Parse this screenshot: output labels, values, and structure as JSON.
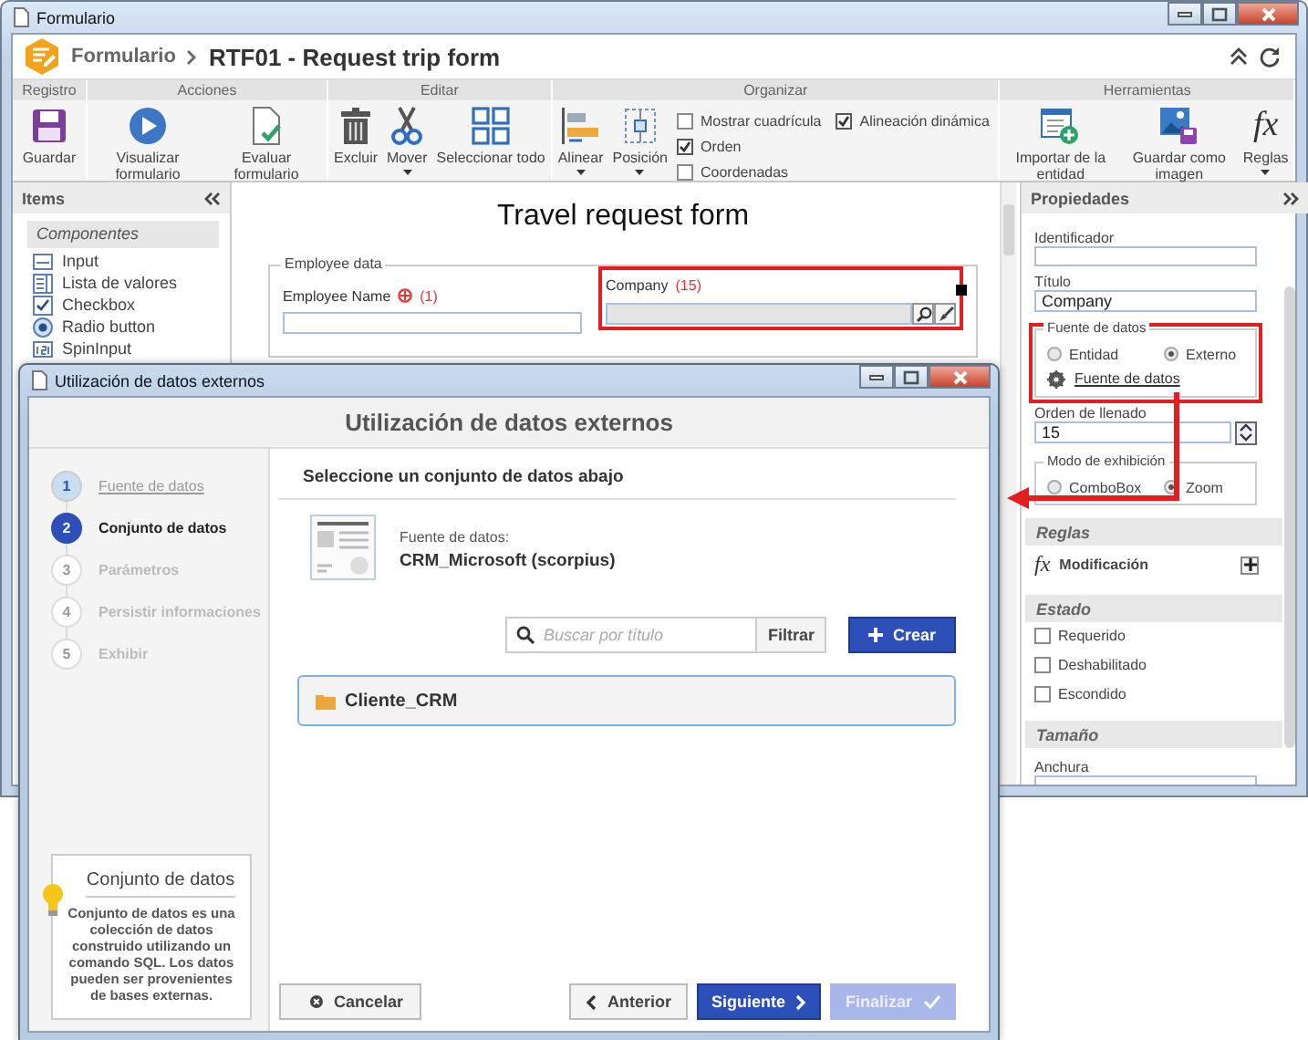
{
  "window": {
    "title": "Formulario"
  },
  "header": {
    "section": "Formulario",
    "title": "RTF01 - Request trip form"
  },
  "ribbon": [
    {
      "label": "Registro",
      "items": [
        {
          "kind": "button",
          "label": "Guardar"
        }
      ]
    },
    {
      "label": "Acciones",
      "items": [
        {
          "kind": "button",
          "label": "Visualizar formulario"
        },
        {
          "kind": "button",
          "label": "Evaluar formulario"
        }
      ]
    },
    {
      "label": "Editar",
      "items": [
        {
          "kind": "button",
          "label": "Excluir"
        },
        {
          "kind": "dropdown",
          "label": "Mover"
        },
        {
          "kind": "button",
          "label": "Seleccionar todo"
        }
      ]
    },
    {
      "label": "Organizar",
      "items": [
        {
          "kind": "dropdown",
          "label": "Alinear"
        },
        {
          "kind": "dropdown",
          "label": "Posición"
        },
        {
          "kind": "checks",
          "options": [
            {
              "label": "Mostrar cuadrícula",
              "checked": false
            },
            {
              "label": "Orden",
              "checked": true
            },
            {
              "label": "Coordenadas",
              "checked": false
            },
            {
              "label": "Alineación dinámica",
              "checked": true
            }
          ]
        }
      ]
    },
    {
      "label": "Herramientas",
      "items": [
        {
          "kind": "button",
          "label": "Importar de la entidad"
        },
        {
          "kind": "button",
          "label": "Guardar como imagen"
        },
        {
          "kind": "dropdown",
          "label": "Reglas",
          "symbol": "fx"
        }
      ]
    }
  ],
  "items_panel": {
    "title": "Items",
    "section": "Componentes",
    "components": [
      "Input",
      "Lista de valores",
      "Checkbox",
      "Radio button",
      "SpinInput"
    ]
  },
  "form": {
    "title": "Travel request form",
    "section": "Employee data",
    "fields": [
      {
        "kind": "text",
        "label": "Employee Name",
        "required": true,
        "order": "(1)",
        "highlighted": false
      },
      {
        "kind": "zoom",
        "label": "Company",
        "required": false,
        "order": "(15)",
        "highlighted": true
      }
    ]
  },
  "properties": {
    "title": "Propiedades",
    "identifier": {
      "label": "Identificador"
    },
    "caption": {
      "label": "Título",
      "value": "Company"
    },
    "data_source": {
      "legend": "Fuente de datos",
      "highlighted": true,
      "options": [
        {
          "label": "Entidad",
          "selected": false
        },
        {
          "label": "Externo",
          "selected": true
        }
      ],
      "link": "Fuente de datos"
    },
    "fill_order": {
      "label": "Orden de llenado",
      "value": "15"
    },
    "display_mode": {
      "legend": "Modo de exhibición",
      "options": [
        {
          "label": "ComboBox",
          "selected": false
        },
        {
          "label": "Zoom",
          "selected": true
        }
      ]
    },
    "rules": {
      "heading": "Reglas",
      "items": [
        {
          "symbol": "fx",
          "label": "Modificación"
        }
      ]
    },
    "state": {
      "heading": "Estado",
      "checks": [
        {
          "label": "Requerido",
          "checked": false
        },
        {
          "label": "Deshabilitado",
          "checked": false
        },
        {
          "label": "Escondido",
          "checked": false
        }
      ]
    },
    "size": {
      "heading": "Tamaño",
      "width_label": "Anchura"
    }
  },
  "dialog": {
    "window_title": "Utilización de datos externos",
    "title": "Utilización de datos externos",
    "steps": [
      {
        "number": "1",
        "label": "Fuente de datos",
        "done": true,
        "selected": false
      },
      {
        "number": "2",
        "label": "Conjunto de datos",
        "done": false,
        "selected": true
      },
      {
        "number": "3",
        "label": "Parámetros",
        "done": false,
        "selected": false
      },
      {
        "number": "4",
        "label": "Persistir informaciones",
        "done": false,
        "selected": false
      },
      {
        "number": "5",
        "label": "Exhibir",
        "done": false,
        "selected": false
      }
    ],
    "tip": {
      "title": "Conjunto de datos",
      "text": "Conjunto de datos es una colección de datos construido utilizando un comando SQL. Los datos pueden ser provenientes de bases externas."
    },
    "heading": "Seleccione un conjunto de datos abajo",
    "source": {
      "label": "Fuente de datos:",
      "name": "CRM_Microsoft (scorpius)"
    },
    "search": {
      "placeholder": "Buscar por título"
    },
    "filter_button": "Filtrar",
    "create_button": "Crear",
    "datasets": [
      {
        "label": "Cliente_CRM",
        "selected": true
      }
    ],
    "buttons": [
      {
        "kind": "cancel",
        "label": "Cancelar",
        "disabled": false
      },
      {
        "kind": "back",
        "label": "Anterior",
        "disabled": false
      },
      {
        "kind": "next",
        "label": "Siguiente",
        "disabled": false
      },
      {
        "kind": "finish",
        "label": "Finalizar",
        "disabled": true
      }
    ]
  }
}
